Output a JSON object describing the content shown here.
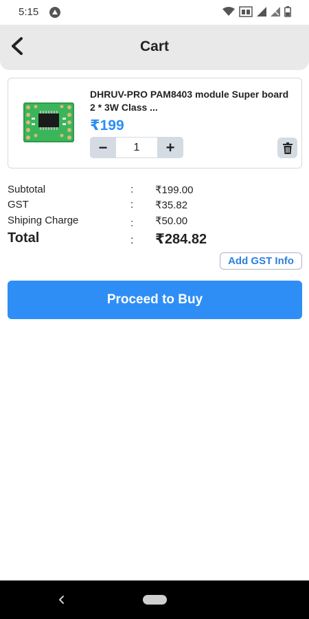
{
  "status_bar": {
    "time": "5:15",
    "icons": [
      "app-icon",
      "wifi-icon",
      "volte-icon",
      "signal-icon",
      "signal-off-icon",
      "battery-icon"
    ]
  },
  "header": {
    "title": "Cart",
    "back_icon": "chevron-left-icon"
  },
  "cart": {
    "items": [
      {
        "name": "DHRUV-PRO PAM8403 module Super board 2 * 3W Class  ...",
        "price": "₹199",
        "quantity": "1",
        "decrement_label": "−",
        "increment_label": "+",
        "image_icon": "circuit-board-image",
        "delete_icon": "trash-icon"
      }
    ]
  },
  "summary": {
    "rows": [
      {
        "label": "Subtotal",
        "colon": ":",
        "value": "₹199.00"
      },
      {
        "label": "GST",
        "colon": ":",
        "value": "₹35.82"
      },
      {
        "label": "Shiping Charge",
        "colon": ":",
        "value": "₹50.00"
      }
    ],
    "total": {
      "label": "Total",
      "colon": ":",
      "value": "₹284.82"
    }
  },
  "actions": {
    "add_gst_label": "Add GST Info",
    "proceed_label": "Proceed to Buy"
  },
  "colors": {
    "accent": "#2e8ef5",
    "price": "#2a8df5",
    "header_bg": "#e9e9e9",
    "stepper_bg": "#d5dbe3"
  }
}
